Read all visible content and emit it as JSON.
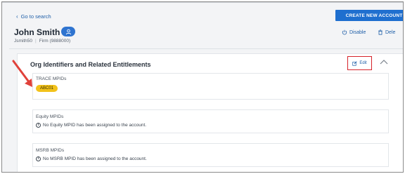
{
  "nav": {
    "back_label": "Go to search"
  },
  "header": {
    "create_button": "CREATE NEW ACCOUNT",
    "name": "John Smith",
    "username": "Jsmith50",
    "firm": "Firm (9888000)",
    "disable_label": "Disable",
    "delete_label": "Dele"
  },
  "card": {
    "title": "Org Identifiers and Related Entitlements",
    "edit_label": "Edit",
    "sections": [
      {
        "label": "TRACE MPIDs",
        "pill": "ABC01"
      },
      {
        "label": "Equity MPIDs",
        "message": "No Equity MPID has been assigned to the account."
      },
      {
        "label": "MSRB MPIDs",
        "message": "No MSRB MPID has been assigned to the account."
      }
    ]
  },
  "colors": {
    "primary": "#1f6fcf",
    "link": "#1f5fa8",
    "highlight_border": "#d6222a",
    "pill": "#f2c21b",
    "arrow": "#e0413a"
  }
}
